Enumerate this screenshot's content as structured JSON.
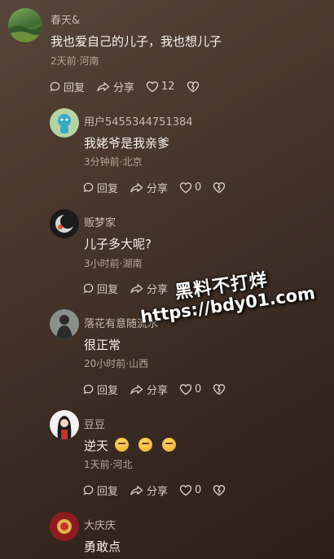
{
  "actions": {
    "reply": "回复",
    "share": "分享"
  },
  "comments": [
    {
      "user": "春天&",
      "text": "我也爱自己的儿子，我也想儿子",
      "meta": "2天前·河南",
      "likes": "12"
    },
    {
      "user": "用户5455344751384",
      "text": "我姥爷是我亲爹",
      "meta": "3分钟前·北京",
      "likes": "0"
    },
    {
      "user": "贩梦家",
      "text": "儿子多大呢?",
      "meta": "3小时前·湖南"
    },
    {
      "user": "落花有意随流水",
      "text": "很正常",
      "meta": "20小时前·山西",
      "likes": "0"
    },
    {
      "user": "豆豆",
      "text": "逆天",
      "meta": "1天前·河北",
      "likes": "0"
    },
    {
      "user": "大庆庆",
      "text": "勇敢点"
    }
  ],
  "watermark": {
    "line1": "黑料不打烊",
    "line2": "https://bdy01.com"
  },
  "colors": {
    "background": "#4a382d",
    "accent": "#f3ece6"
  },
  "icons": [
    "reply-icon",
    "share-icon",
    "heart-icon",
    "dislike-heart-icon",
    "thinking-emoji"
  ]
}
